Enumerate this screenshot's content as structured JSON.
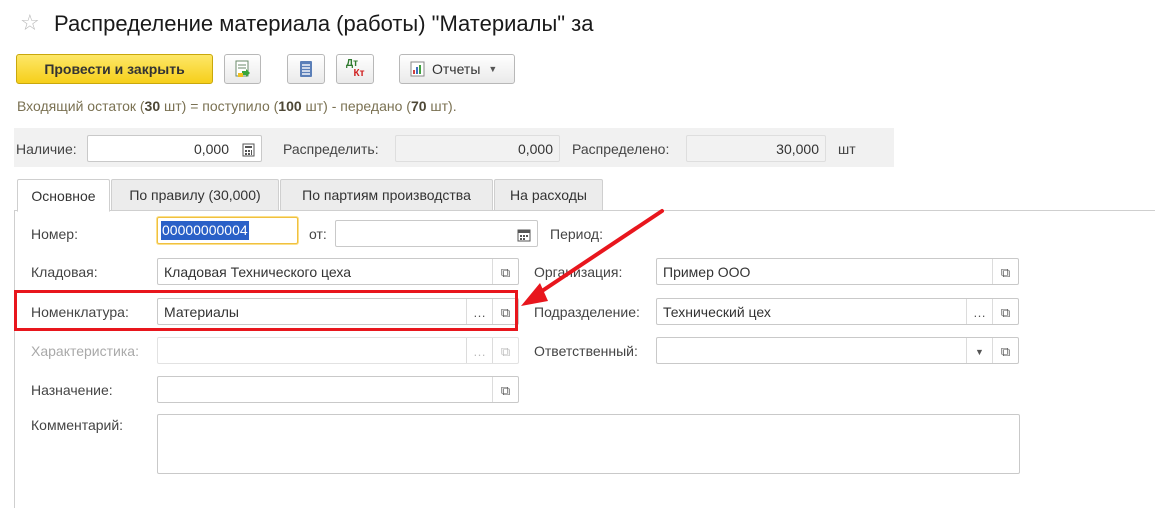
{
  "header": {
    "star_icon": "star-icon",
    "title": "Распределение материала (работы) \"Материалы\" за"
  },
  "toolbar": {
    "post_close_label": "Провести и закрыть",
    "post_icon": "post-document-icon",
    "list_icon": "list-icon",
    "dtkt_top": "Дт",
    "dtkt_bottom": "Кт",
    "reports_label": "Отчеты",
    "reports_icon": "report-icon"
  },
  "info": {
    "prefix": "Входящий остаток (",
    "balance": "30",
    "unit1": " шт) = поступило (",
    "received": "100",
    "unit2": " шт) - передано (",
    "transferred": "70",
    "unit3": " шт)."
  },
  "summary": {
    "availability_label": "Наличие:",
    "availability_value": "0,000",
    "distribute_label": "Распределить:",
    "distribute_value": "0,000",
    "distributed_label": "Распределено:",
    "distributed_value": "30,000",
    "unit": "шт"
  },
  "tabs": [
    {
      "label": "Основное",
      "active": true
    },
    {
      "label": "По правилу (30,000)",
      "active": false
    },
    {
      "label": "По партиям производства",
      "active": false
    },
    {
      "label": "На расходы",
      "active": false
    }
  ],
  "form": {
    "number_label": "Номер:",
    "number_value": "00000000004",
    "date_label": "от:",
    "date_value": "",
    "period_label": "Период:",
    "warehouse_label": "Кладовая:",
    "warehouse_value": "Кладовая Технического цеха",
    "organization_label": "Организация:",
    "organization_value": "Пример ООО",
    "nomenclature_label": "Номенклатура:",
    "nomenclature_value": "Материалы",
    "department_label": "Подразделение:",
    "department_value": "Технический цех",
    "characteristic_label": "Характеристика:",
    "characteristic_value": "",
    "responsible_label": "Ответственный:",
    "responsible_value": "",
    "purpose_label": "Назначение:",
    "purpose_value": "",
    "comment_label": "Комментарий:",
    "comment_value": ""
  },
  "colors": {
    "primary_button": "#f6cf1a",
    "highlight": "#e8161d",
    "selection": "#2a60c7"
  }
}
